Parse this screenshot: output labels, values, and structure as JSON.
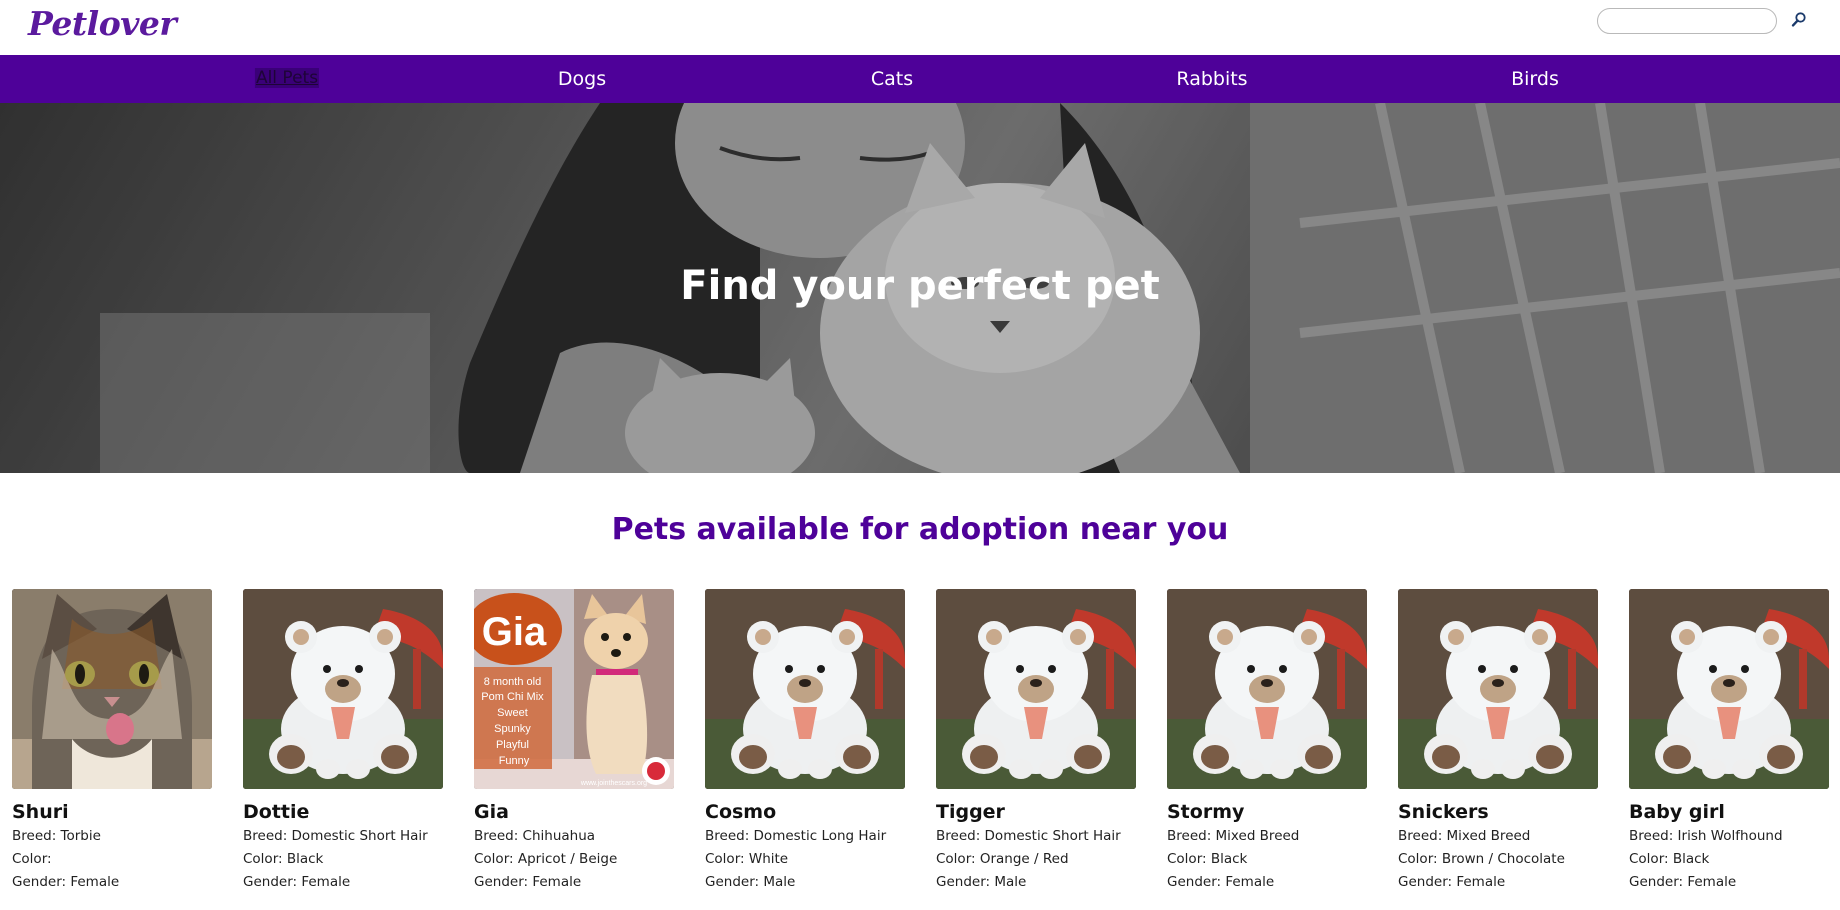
{
  "header": {
    "logo": "Petlover",
    "search": {
      "placeholder": "",
      "value": ""
    }
  },
  "nav": {
    "items": [
      {
        "label": "All Pets",
        "active": true
      },
      {
        "label": "Dogs"
      },
      {
        "label": "Cats"
      },
      {
        "label": "Rabbits"
      },
      {
        "label": "Birds"
      }
    ]
  },
  "hero": {
    "title": "Find your perfect pet"
  },
  "section": {
    "title": "Pets available for adoption near you"
  },
  "pets": [
    {
      "name": "Shuri",
      "breed": "Breed: Torbie",
      "color": "Color:",
      "gender": "Gender: Female",
      "photo": "cat-photo"
    },
    {
      "name": "Dottie",
      "breed": "Breed: Domestic Short Hair",
      "color": "Color: Black",
      "gender": "Gender: Female",
      "photo": "teddy-bear-placeholder"
    },
    {
      "name": "Gia",
      "breed": "Breed: Chihuahua",
      "color": "Color: Apricot / Beige",
      "gender": "Gender: Female",
      "photo": "dog-flyer-photo",
      "flyer": {
        "title": "Gia",
        "lines": [
          "8 month old",
          "Pom Chi Mix",
          "Sweet",
          "Spunky",
          "Playful",
          "Funny"
        ],
        "url": "www.jointhescars.org"
      }
    },
    {
      "name": "Cosmo",
      "breed": "Breed: Domestic Long Hair",
      "color": "Color: White",
      "gender": "Gender: Male",
      "photo": "teddy-bear-placeholder"
    },
    {
      "name": "Tigger",
      "breed": "Breed: Domestic Short Hair",
      "color": "Color: Orange / Red",
      "gender": "Gender: Male",
      "photo": "teddy-bear-placeholder"
    },
    {
      "name": "Stormy",
      "breed": "Breed: Mixed Breed",
      "color": "Color: Black",
      "gender": "Gender: Female",
      "photo": "teddy-bear-placeholder"
    },
    {
      "name": "Snickers",
      "breed": "Breed: Mixed Breed",
      "color": "Color: Brown / Chocolate",
      "gender": "Gender: Female",
      "photo": "teddy-bear-placeholder"
    },
    {
      "name": "Baby girl",
      "breed": "Breed: Irish Wolfhound",
      "color": "Color: Black",
      "gender": "Gender: Female",
      "photo": "teddy-bear-placeholder"
    }
  ],
  "colors": {
    "brand": "#4e0199",
    "logo": "#5b1a9e"
  },
  "icons": {
    "search": "search-icon"
  }
}
